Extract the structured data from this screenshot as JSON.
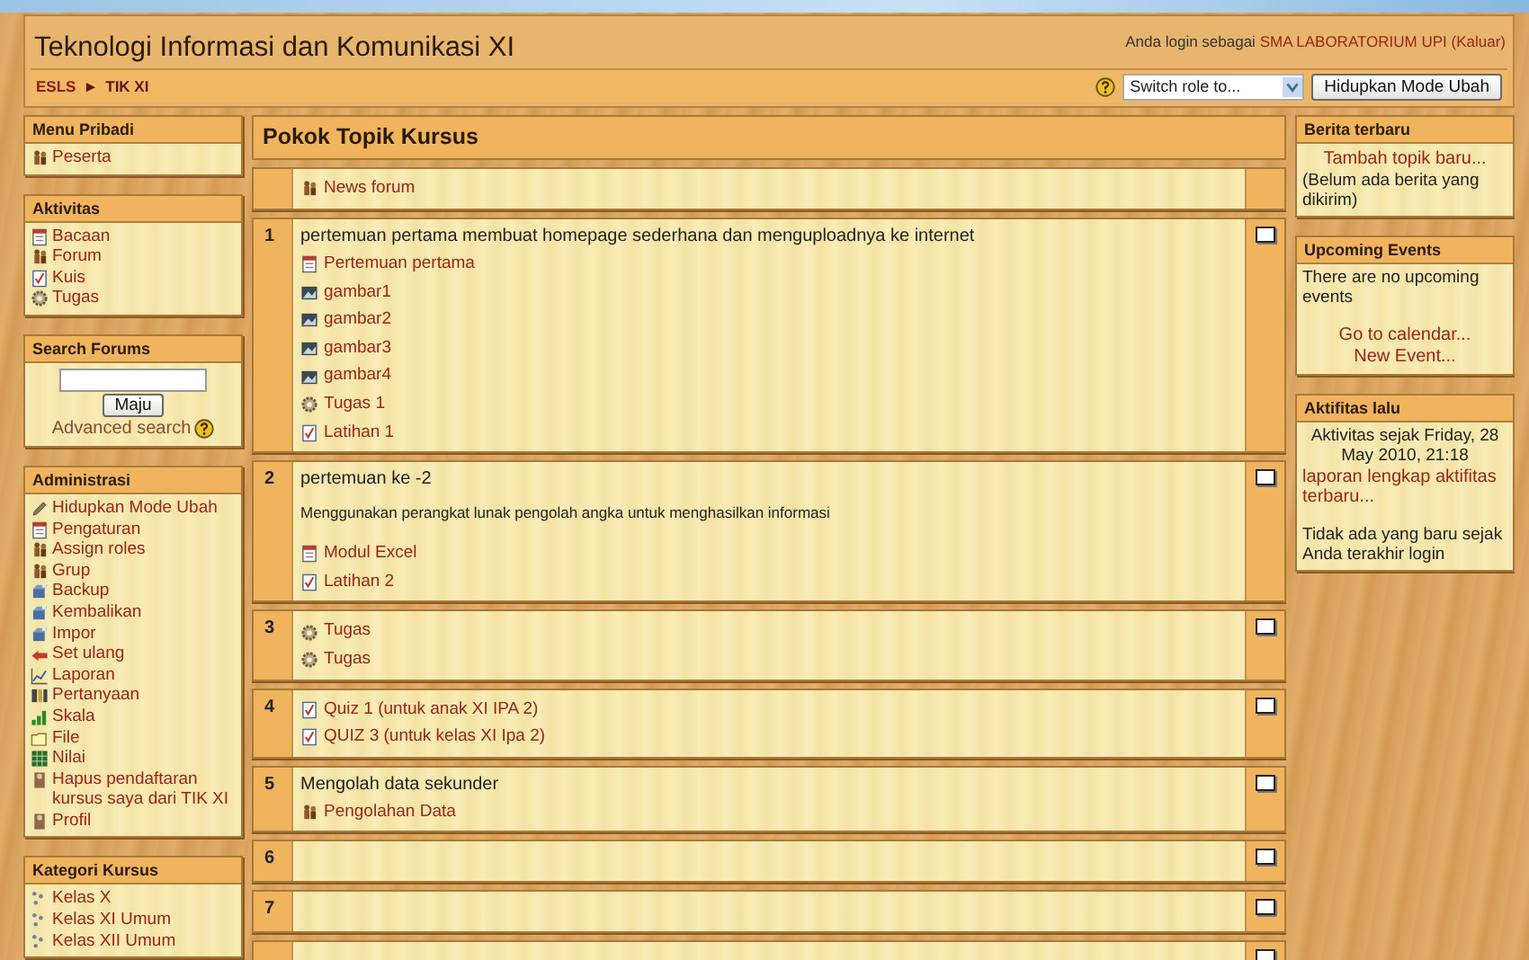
{
  "header": {
    "title": "Teknologi Informasi dan Komunikasi XI",
    "login": {
      "prefix": "Anda login sebagai",
      "user": "SMA LABORATORIUM UPI",
      "logout": "(Kaluar)"
    },
    "breadcrumb": [
      {
        "text": "ESLS",
        "kind": "link"
      },
      {
        "text": "►",
        "kind": "separator"
      },
      {
        "text": "TIK XI",
        "kind": "current"
      }
    ],
    "role_select": {
      "value": "Switch role to..."
    },
    "edit_button": "Hidupkan Mode Ubah"
  },
  "left_blocks": [
    {
      "title": "Menu Pribadi",
      "parts": [
        {
          "kind": "list",
          "items": [
            {
              "kind": "people",
              "label": "Peserta"
            }
          ]
        }
      ]
    },
    {
      "title": "Aktivitas",
      "parts": [
        {
          "kind": "list",
          "items": [
            {
              "kind": "document",
              "label": "Bacaan"
            },
            {
              "kind": "people",
              "label": "Forum"
            },
            {
              "kind": "checklist",
              "label": "Kuis"
            },
            {
              "kind": "gear",
              "label": "Tugas"
            }
          ]
        }
      ]
    },
    {
      "title": "Search Forums",
      "parts": [
        {
          "kind": "field"
        },
        {
          "kind": "button",
          "text": "Maju"
        },
        {
          "kind": "helplink",
          "text": "Advanced search"
        }
      ]
    },
    {
      "title": "Administrasi",
      "parts": [
        {
          "kind": "list",
          "items": [
            {
              "kind": "pencil",
              "label": "Hidupkan Mode Ubah"
            },
            {
              "kind": "document",
              "label": "Pengaturan"
            },
            {
              "kind": "people",
              "label": "Assign roles"
            },
            {
              "kind": "people",
              "label": "Grup"
            },
            {
              "kind": "box",
              "label": "Backup"
            },
            {
              "kind": "box",
              "label": "Kembalikan"
            },
            {
              "kind": "box",
              "label": "Impor"
            },
            {
              "kind": "arrow",
              "label": "Set ulang"
            },
            {
              "kind": "linechart",
              "label": "Laporan"
            },
            {
              "kind": "grid",
              "label": "Pertanyaan"
            },
            {
              "kind": "bars",
              "label": "Skala"
            },
            {
              "kind": "folder",
              "label": "File"
            },
            {
              "kind": "table",
              "label": "Nilai"
            },
            {
              "kind": "person",
              "label": "Hapus pendaftaran kursus saya dari TIK XI"
            },
            {
              "kind": "person",
              "label": "Profil"
            }
          ]
        }
      ]
    },
    {
      "title": "Kategori Kursus",
      "parts": [
        {
          "kind": "list",
          "items": [
            {
              "kind": "dots",
              "label": "Kelas X"
            },
            {
              "kind": "dots",
              "label": "Kelas XI Umum"
            },
            {
              "kind": "dots",
              "label": "Kelas XII Umum"
            }
          ]
        }
      ]
    }
  ],
  "course": {
    "title": "Pokok Topik Kursus",
    "sections": [
      {
        "kind": "intro",
        "items": [
          {
            "kind": "people",
            "label": "News forum"
          }
        ]
      },
      {
        "kind": "topic",
        "number": "1",
        "summary": [
          "pertemuan pertama membuat homepage sederhana dan menguploadnya ke internet"
        ],
        "items": [
          {
            "kind": "document",
            "label": "Pertemuan pertama"
          },
          {
            "kind": "image",
            "label": "gambar1"
          },
          {
            "kind": "image",
            "label": "gambar2"
          },
          {
            "kind": "image",
            "label": "gambar3"
          },
          {
            "kind": "image",
            "label": "gambar4"
          },
          {
            "kind": "gear",
            "label": "Tugas 1"
          },
          {
            "kind": "checklist",
            "label": "Latihan 1"
          }
        ]
      },
      {
        "kind": "topic",
        "number": "2",
        "summary": [
          "pertemuan ke -2",
          "Menggunakan perangkat lunak  pengolah angka untuk menghasilkan informasi"
        ],
        "items": [
          {
            "kind": "document",
            "label": "Modul Excel"
          },
          {
            "kind": "checklist",
            "label": "Latihan 2"
          }
        ]
      },
      {
        "kind": "topic",
        "number": "3",
        "items": [
          {
            "kind": "gear",
            "label": "Tugas"
          },
          {
            "kind": "gear",
            "label": "Tugas"
          }
        ]
      },
      {
        "kind": "topic",
        "number": "4",
        "items": [
          {
            "kind": "checklist",
            "label": "Quiz 1 (untuk anak XI IPA 2)"
          },
          {
            "kind": "checklist",
            "label": "QUIZ 3 (untuk kelas XI Ipa 2)"
          }
        ]
      },
      {
        "kind": "topic",
        "number": "5",
        "summary": [
          "Mengolah data sekunder"
        ],
        "items": [
          {
            "kind": "people",
            "label": "Pengolahan Data"
          }
        ]
      },
      {
        "kind": "topic",
        "number": "6"
      },
      {
        "kind": "topic",
        "number": "7"
      },
      {
        "kind": "topic"
      }
    ]
  },
  "right_blocks": [
    {
      "title": "Berita terbaru",
      "parts": [
        {
          "kind": "link",
          "text": "Tambah topik baru..."
        },
        {
          "kind": "text",
          "text": "(Belum ada berita yang dikirim)"
        }
      ]
    },
    {
      "title": "Upcoming Events",
      "parts": [
        {
          "kind": "text",
          "text": "There are no upcoming events"
        },
        {
          "kind": "spacer"
        },
        {
          "kind": "link",
          "text": "Go to calendar..."
        },
        {
          "kind": "link",
          "text": "New Event..."
        }
      ]
    },
    {
      "title": "Aktifitas lalu",
      "parts": [
        {
          "kind": "note",
          "text": "Aktivitas sejak Friday, 28 May 2010, 21:18"
        },
        {
          "kind": "link",
          "text": "laporan lengkap aktifitas terbaru..."
        },
        {
          "kind": "spacer"
        },
        {
          "kind": "text",
          "text": "Tidak ada yang baru sejak Anda terakhir login"
        }
      ]
    }
  ]
}
